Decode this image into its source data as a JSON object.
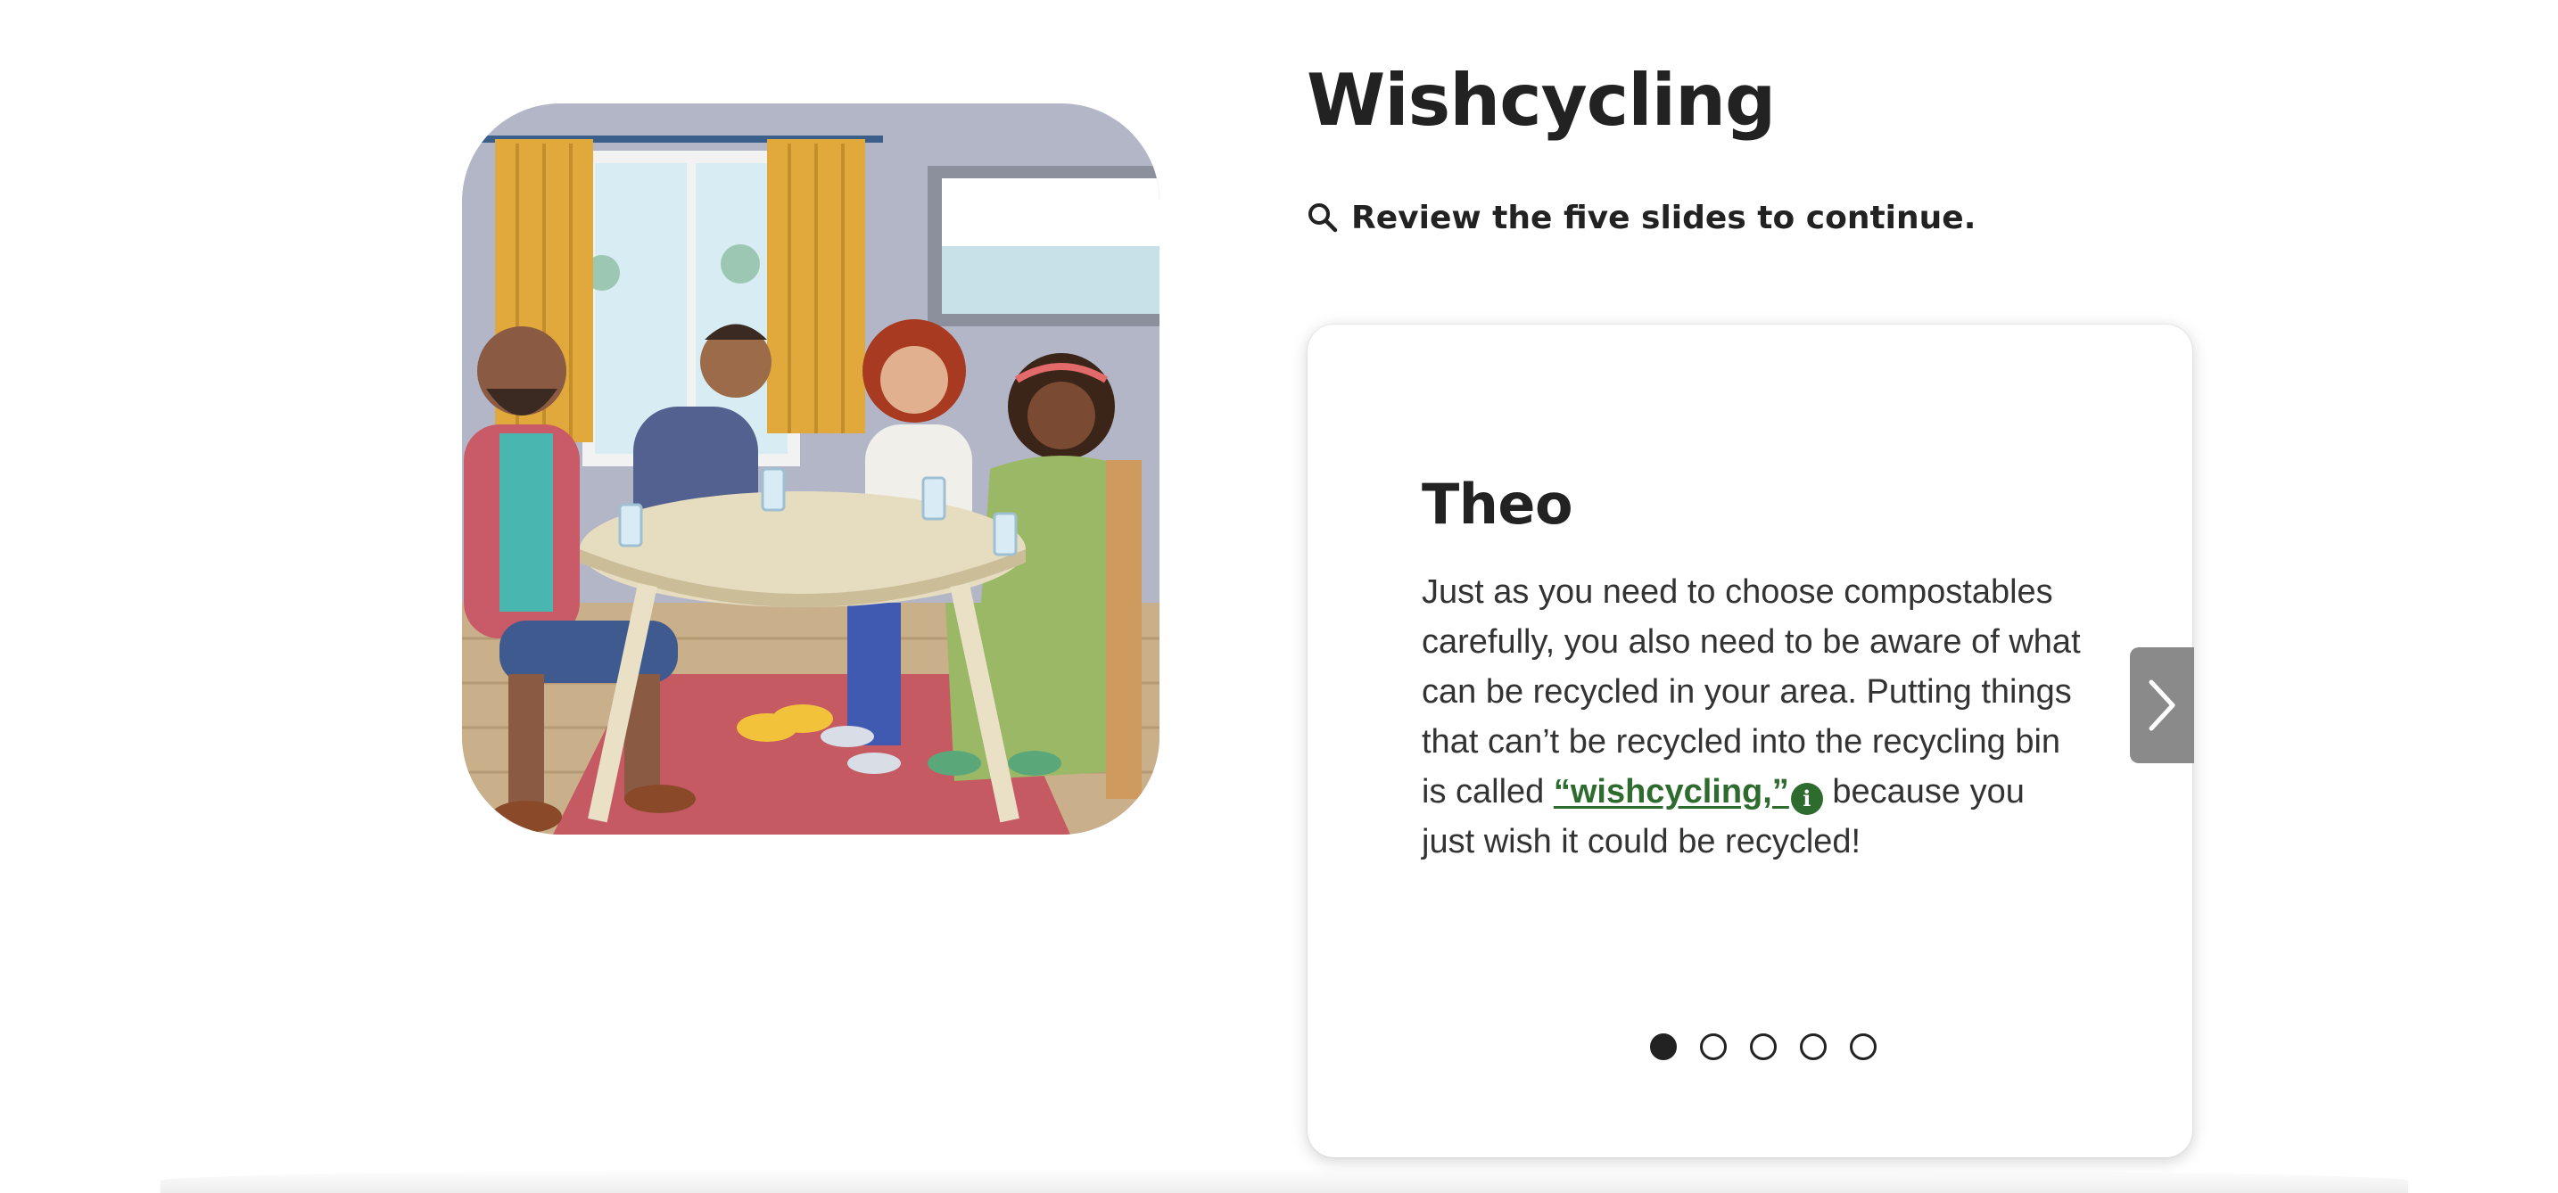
{
  "page": {
    "title": "Wishcycling",
    "instruction": "Review the five slides to continue.",
    "instruction_icon": "search-icon"
  },
  "illustration": {
    "icon": "family-dinner-table-illustration"
  },
  "slide": {
    "title": "Theo",
    "body_before": "Just as you need to choose compostables carefully, you also need to be aware of what can be recycled in your area. Putting things that can’t be recycled into the recycling bin is called ",
    "term": "“wishcycling,”",
    "info_icon": "info-icon",
    "info_glyph": "i",
    "body_after": " because you just wish it could be recycled!"
  },
  "navigation": {
    "next_icon": "chevron-right-icon",
    "total_slides": 5,
    "current_slide": 1
  },
  "colors": {
    "link": "#2e6b2e",
    "heading": "#222222",
    "next_button": "#8a8a8a"
  }
}
